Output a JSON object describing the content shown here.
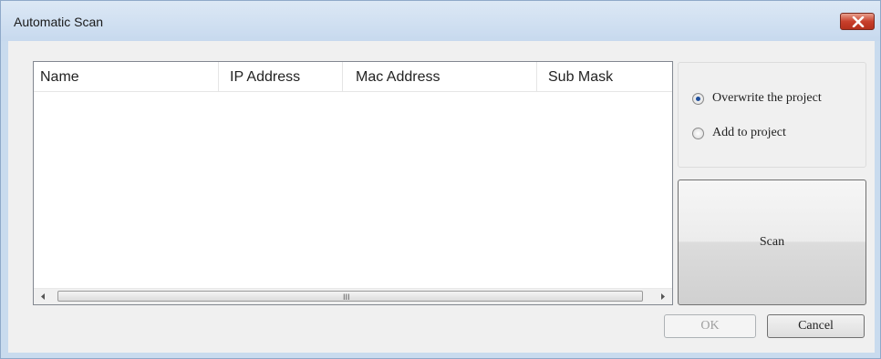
{
  "window": {
    "title": "Automatic Scan"
  },
  "list": {
    "columns": [
      "Name",
      "IP Address",
      "Mac Address",
      "Sub Mask"
    ],
    "rows": [],
    "scrollbar_grip": "III"
  },
  "options": {
    "items": [
      {
        "label": "Overwrite the project",
        "selected": true
      },
      {
        "label": "Add to project",
        "selected": false
      }
    ]
  },
  "buttons": {
    "scan": "Scan",
    "ok": "OK",
    "cancel": "Cancel"
  },
  "icons": {
    "close": "close-icon",
    "scroll_left": "arrow-left-icon",
    "scroll_right": "arrow-right-icon"
  },
  "colors": {
    "close_button": "#c8402c",
    "title_bar": "#c7d9ee",
    "radio_dot": "#1f4f9c"
  }
}
